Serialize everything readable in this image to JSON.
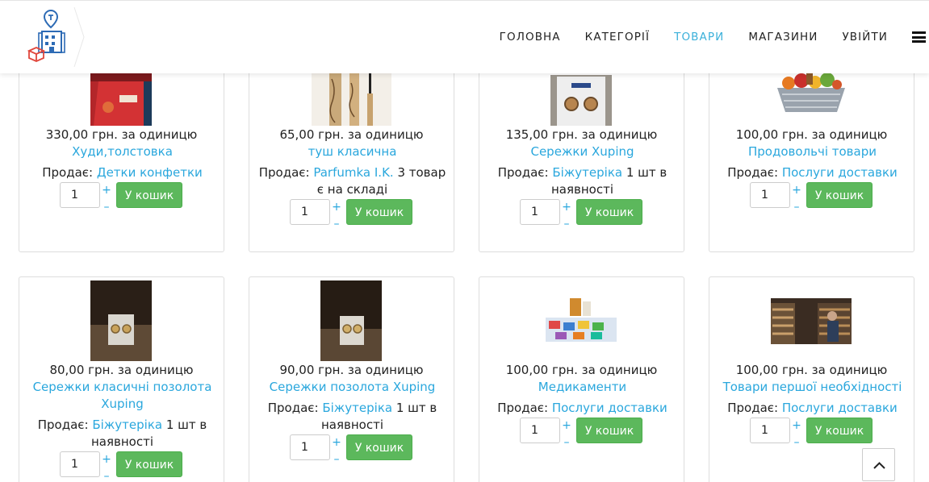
{
  "nav": {
    "items": [
      "ГОЛОВНА",
      "КАТЕГОРІЇ",
      "ТОВАРИ",
      "МАГАЗИНИ",
      "УВІЙТИ"
    ],
    "active": "ТОВАРИ"
  },
  "icons": {
    "logo": "shop-location-logo",
    "menu": "hamburger-icon",
    "to_top": "chevron-up-icon"
  },
  "colors": {
    "accent": "#2aa7dd",
    "button": "#5cb85c"
  },
  "labels": {
    "seller_prefix": "Продає:",
    "add_to_cart": "У кошик",
    "plus": "+",
    "minus": "–"
  },
  "products": [
    {
      "price": "330,00 грн. за одиницю",
      "name": "Худи,толстовка",
      "seller": "Детки конфетки",
      "stock": "",
      "qty": "1"
    },
    {
      "price": "65,00 грн. за одиницю",
      "name": "туш класична",
      "seller": "Parfumka I.K.",
      "stock": "3 товар є на складі",
      "qty": "1"
    },
    {
      "price": "135,00 грн. за одиницю",
      "name": "Сережки Xuping",
      "seller": "Біжутеріка",
      "stock": "1 шт в наявності",
      "qty": "1"
    },
    {
      "price": "100,00 грн. за одиницю",
      "name": "Продовольчі товари",
      "seller": "Послуги доставки",
      "stock": "",
      "qty": "1"
    },
    {
      "price": "80,00 грн. за одиницю",
      "name": "Сережки класичні позолота Xuping",
      "seller": "Біжутеріка",
      "stock": "1 шт в наявності",
      "qty": "1"
    },
    {
      "price": "90,00 грн. за одиницю",
      "name": "Сережки позолота Xuping",
      "seller": "Біжутеріка",
      "stock": "1 шт в наявності",
      "qty": "1"
    },
    {
      "price": "100,00 грн. за одиницю",
      "name": "Медикаменти",
      "seller": "Послуги доставки",
      "stock": "",
      "qty": "1"
    },
    {
      "price": "100,00 грн. за одиницю",
      "name": "Товари першої необхідності",
      "seller": "Послуги доставки",
      "stock": "",
      "qty": "1"
    }
  ]
}
